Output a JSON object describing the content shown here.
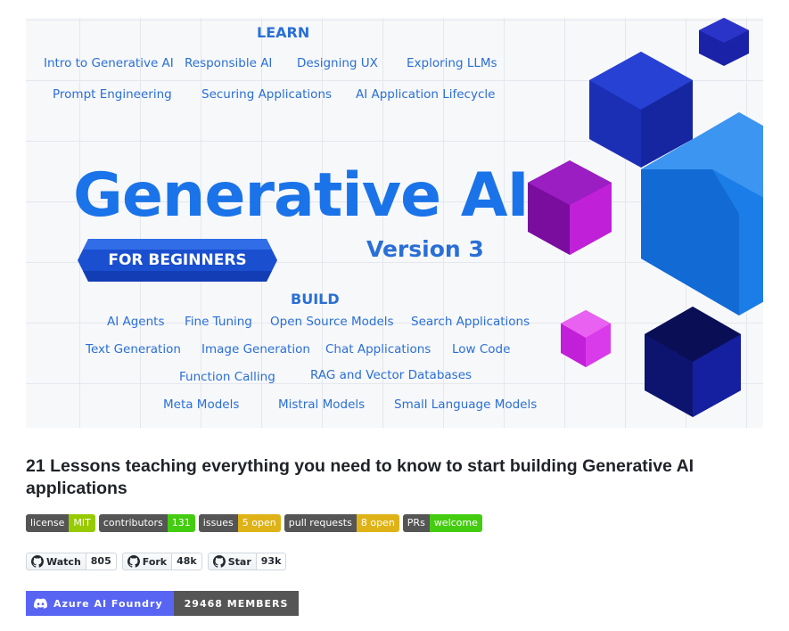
{
  "banner": {
    "learn_heading": "LEARN",
    "learn_row1": [
      "Intro to Generative AI",
      "Responsible AI",
      "Designing UX",
      "Exploring LLMs"
    ],
    "learn_row2": [
      "Prompt Engineering",
      "Securing Applications",
      "AI Application Lifecycle"
    ],
    "headline": "Generative AI",
    "ribbon": "FOR BEGINNERS",
    "version": "Version 3",
    "build_heading": "BUILD",
    "build_row1": [
      "AI Agents",
      "Fine Tuning",
      "Open Source Models",
      "Search Applications"
    ],
    "build_row2": [
      "Text Generation",
      "Image Generation",
      "Chat Applications",
      "Low Code"
    ],
    "build_row3": [
      "Function Calling",
      "RAG and Vector Databases"
    ],
    "build_row4": [
      "Meta Models",
      "Mistral Models",
      "Small Language Models"
    ]
  },
  "title": "21 Lessons teaching everything you need to know to start building Generative AI applications",
  "badges": [
    {
      "label": "license",
      "value": "MIT",
      "color": "#97ca00"
    },
    {
      "label": "contributors",
      "value": "131",
      "color": "#4c1"
    },
    {
      "label": "issues",
      "value": "5 open",
      "color": "#dfb317"
    },
    {
      "label": "pull requests",
      "value": "8 open",
      "color": "#dfb317"
    },
    {
      "label": "PRs",
      "value": "welcome",
      "color": "#4c1"
    }
  ],
  "github": [
    {
      "label": "Watch",
      "count": "805",
      "icon": "github-icon"
    },
    {
      "label": "Fork",
      "count": "48k",
      "icon": "github-icon"
    },
    {
      "label": "Star",
      "count": "93k",
      "icon": "github-icon"
    }
  ],
  "discord": {
    "label": "Azure AI Foundry",
    "value": "29468 MEMBERS",
    "icon": "discord-icon",
    "color": "#5865f2"
  }
}
